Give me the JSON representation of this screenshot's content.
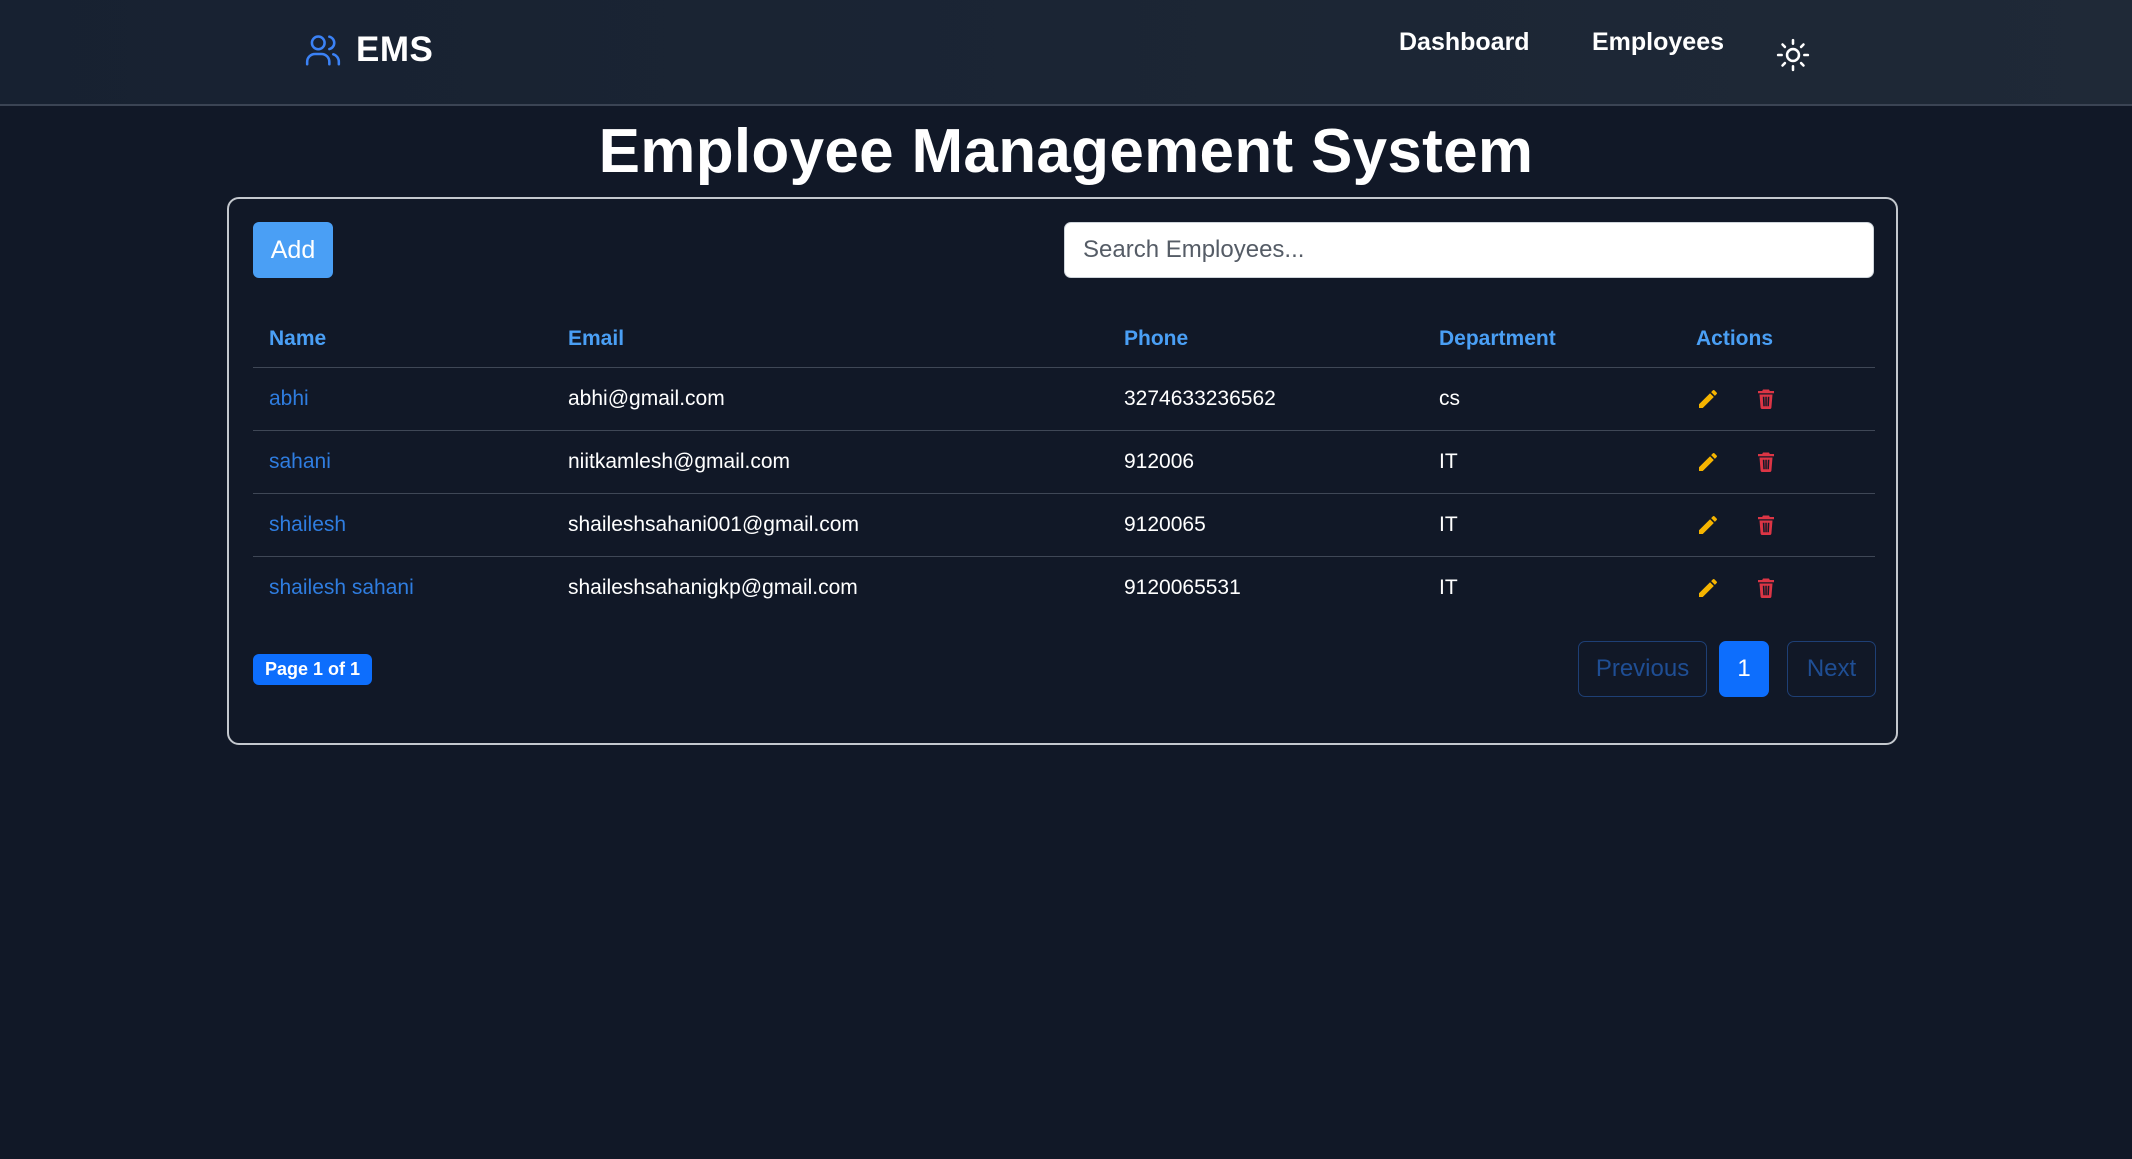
{
  "nav": {
    "brand": "EMS",
    "links": [
      {
        "label": "Dashboard"
      },
      {
        "label": "Employees"
      }
    ],
    "theme_icon": "sun-icon"
  },
  "page": {
    "title": "Employee Management System"
  },
  "toolbar": {
    "add_label": "Add",
    "search_placeholder": "Search Employees..."
  },
  "table": {
    "headers": [
      "Name",
      "Email",
      "Phone",
      "Department",
      "Actions"
    ],
    "rows": [
      {
        "name": "abhi",
        "email": "abhi@gmail.com",
        "phone": "3274633236562",
        "department": "cs"
      },
      {
        "name": "sahani",
        "email": "niitkamlesh@gmail.com",
        "phone": "912006",
        "department": "IT"
      },
      {
        "name": "shailesh",
        "email": "shaileshsahani001@gmail.com",
        "phone": "9120065",
        "department": "IT"
      },
      {
        "name": "shailesh sahani",
        "email": "shaileshsahanigkp@gmail.com",
        "phone": "9120065531",
        "department": "IT"
      }
    ],
    "action_icons": [
      "pencil-icon",
      "trash-icon"
    ]
  },
  "pagination": {
    "badge": "Page 1 of 1",
    "previous": "Previous",
    "current": "1",
    "next": "Next"
  },
  "colors": {
    "background": "#111827",
    "accent": "#4a9ff5",
    "primary": "#0d6efd",
    "edit": "#f5b400",
    "delete": "#dc3545"
  }
}
